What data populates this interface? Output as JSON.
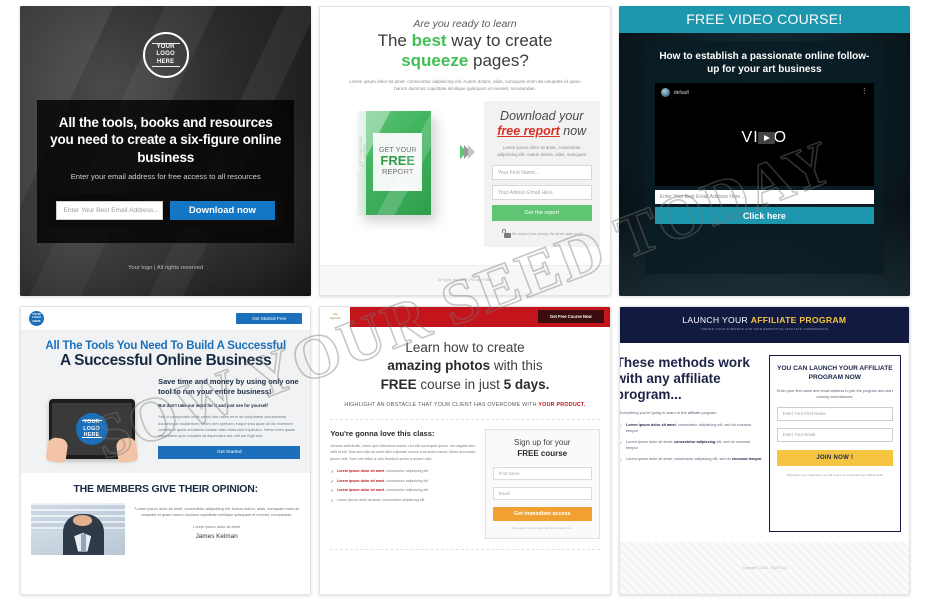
{
  "watermark": {
    "text": "SOW YOUR SEED TODAY"
  },
  "templates": [
    {
      "id": "dark-six-figure-hero",
      "logo": {
        "line1": "YOUR",
        "line2": "LOGO",
        "line3": "HERE"
      },
      "headline": "All the tools, books and resources you need to create a six-figure online business",
      "subheadline": "Enter your email address for free access to all resources",
      "email_placeholder": "Enter Your Best Email Address...",
      "cta_label": "Download now",
      "footer": "Your logo | All rights reserved",
      "accent": "#1377c5"
    },
    {
      "id": "squeeze-free-report",
      "kicker": "Are you ready to learn",
      "headline_line1_a": "The ",
      "headline_line1_b": "best",
      "headline_line1_c": " way to create",
      "headline_line2_a": "squeeze",
      "headline_line2_b": " pages?",
      "lorem": "Lorem ipsum dolor sit amet, consectetur adipisicing elit. Autem dolore, alias, numquam enim ab voluptate id quam harum dacimus cupiditate similique quisquam et eveniet, recusandae.",
      "book": {
        "spine": "GET YOUR FREE REPORT",
        "face_line1": "GET YOUR",
        "face_line2": "FREE",
        "face_line3": "REPORT"
      },
      "optin": {
        "title_a": "Download your",
        "title_b": "free report",
        "title_c": " now",
        "lorem": "Lorem ipsum dolor sit amet, consectetur adipisicing elit. Autem dolore, alias, numquam",
        "first_name_placeholder": "Your First Name...",
        "email_placeholder": "Your Adress Email Here",
        "cta_label": "Get the report",
        "privacy": "We respect your privacy, the all we spam you!!!"
      },
      "footer": "All rights reserved | Privacy Policy",
      "accent": "#5fc572"
    },
    {
      "id": "free-video-course",
      "topbar": "FREE VIDEO COURSE!",
      "headline": "How to establish a passionate online follow-up for your art business",
      "player": {
        "channel": "default",
        "word_a": "VI",
        "word_b": "O",
        "menu_icon": "kebab-menu-icon"
      },
      "email_placeholder": "Enter Your Best Email Address Here ...",
      "cta_label": "Click here",
      "accent": "#1c97ae"
    },
    {
      "id": "blue-all-the-tools",
      "nav": {
        "logo": {
          "line1": "YOUR",
          "line2": "LOGO",
          "line3": "HERE"
        },
        "cta_label": "Get Started Free"
      },
      "headline_top": "All The Tools You Need To Build A Successful",
      "headline_main": "A Successful Online Business",
      "tablet_logo": {
        "line1": "YOUR",
        "line2": "LOGO",
        "line3": "HERE"
      },
      "copy": {
        "heading": "Save time and money by using only one tool to run your entire business!",
        "bold": "But don't take our word for it and just see for yourself",
        "body": "Sed ut perspiciatis unde omnis iste natus error sit voluptatem accusantium doloremque laudantium, totam rem aperiam, eaque ipsa quae ab illo inventore veritatis et quasi architecto beatae vitae dicta sunt explicabo. Nemo enim ipsam voluptatem quia voluptas sit aspernatur aut odit aut fugit sed.",
        "cta_label": "Get Started"
      },
      "members": {
        "title": "THE MEMBERS GIVE THEIR OPINION:",
        "quote": "\"Lorem ipsum dolor sit amet, consectetur adipisicing elit. Autem dolore, alias, numquam enim ab voluptate id quam harum ducimus cupiditate similique quisquam et eveniet, recusandae.",
        "sub": "Lorem ipsum dolor sit amet",
        "name": "James Kelman"
      },
      "accent": "#1c6fba"
    },
    {
      "id": "red-photo-course",
      "nav": {
        "logo_line1": "Your",
        "logo_line2": "logo here",
        "cta_label": "Get Free Course Now"
      },
      "headline_l1": "Learn how to create",
      "headline_l2_a": "amazing photos",
      "headline_l2_b": " with this",
      "headline_l3_a": "FREE",
      "headline_l3_b": " course in just ",
      "headline_l3_c": "5 days.",
      "sub_a": "HIGHLIGHT AN OBSTACLE THAT YOUR CLIENT HAS OVERCOME WITH ",
      "sub_b": "YOUR PRODUCT.",
      "left": {
        "heading": "You're gonna love this class:",
        "body": "Aenean sollicitudin, lorem quis bibendum auctor, nisi elit consequat ipsum, nec sagittis sem nibh id elit. Duis sed odio sit amet nibh vulputate cursus a sit amet mauris. Morbi accumsan ipsum velit. Nam nec tellus a odio tincidunt auctor a ornare odio.",
        "bullets": [
          {
            "bold": "Lorem ipsum dolor sit amet",
            "rest": ", consectetur adipisicing elit."
          },
          {
            "bold": "Lorem ipsum dolor sit amet",
            "rest": ", consectetur adipisicing elit."
          },
          {
            "bold": "Lorem ipsum dolor sit amet",
            "rest": ", consectetur adipisicing elit."
          },
          {
            "bold": "Lorem ipsum dolor sit amet",
            "rest": ", consectetur adipisicing elit."
          }
        ]
      },
      "form": {
        "title_a": "Sign up for your",
        "title_b": "FREE course",
        "first_name_placeholder": "First name",
        "email_placeholder": "Email",
        "cta_label": "Get immediate access",
        "privacy": "We respect your privacy. We will not spam you."
      },
      "accent": "#c4141c",
      "cta_color": "#f0a132"
    },
    {
      "id": "affiliate-program",
      "nav": {
        "title_a": "LAUNCH YOUR ",
        "title_b": "AFFILIATE PROGRAM",
        "subtitle": "CREATE YOUR AUDIENCE AND TAKE REPETITIVE AFFILIATE COMMISSIONS"
      },
      "headline": "These methods work with any affiliate program...",
      "intro": "Everything you're going to learn in the affiliate program",
      "bullets": [
        {
          "bold": "Lorem ipsum dolor sit amet",
          "rest": ", consectetur adipisicing elit, sed do eiusmod tempor"
        },
        {
          "pre": "Lorem ipsum dolor sit amet, ",
          "bold": "consectetur adipiscing",
          "rest": " elit, sed do eiusmod tempor"
        },
        {
          "pre": "Lorem ipsum dolor sit amet, consectetur adipiscing elit, sed do ",
          "bold": "eiusmod tempor",
          "rest": ""
        }
      ],
      "form": {
        "title": "YOU CAN LAUNCH YOUR AFFILIATE PROGRAM NOW",
        "subtitle": "Enter your first name and email address to join the program and start earning commissions:",
        "first_name_placeholder": "Enter Your First Name",
        "email_placeholder": "Enter Your Email",
        "cta_label": "JOIN NOW !",
        "note": "Right after your registration you will receive an email with your affiliate links"
      },
      "footer": "Copyright © 2020 - YACHT Ltd",
      "accent": "#f5c542"
    }
  ]
}
